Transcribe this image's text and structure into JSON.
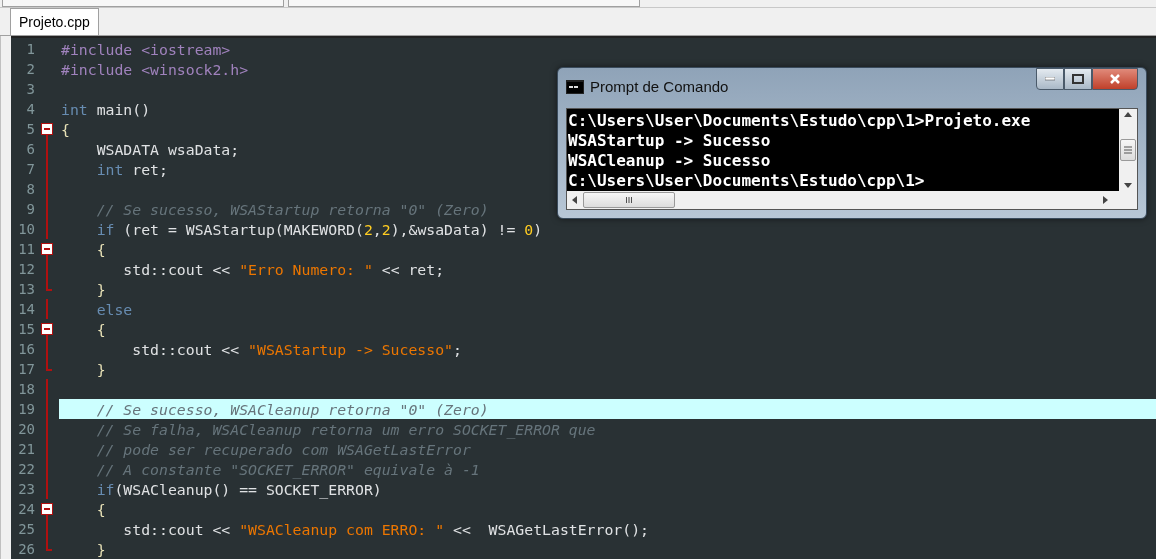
{
  "tabs": [
    {
      "label": "Projeto.cpp",
      "selected": true
    }
  ],
  "editor": {
    "lines": [
      {
        "number": "1",
        "kind": "plain",
        "highlighted": false,
        "tokens": [
          {
            "kind": "preproc",
            "text": "#include <iostream>"
          }
        ]
      },
      {
        "number": "2",
        "kind": "plain",
        "highlighted": false,
        "tokens": [
          {
            "kind": "preproc",
            "text": "#include <winsock2.h>"
          }
        ]
      },
      {
        "number": "3",
        "kind": "plain",
        "highlighted": false
      },
      {
        "number": "4",
        "kind": "plain",
        "highlighted": false,
        "tokens": [
          {
            "kind": "keyword",
            "text": "int"
          },
          {
            "kind": "plain",
            "text": " main()"
          }
        ]
      },
      {
        "number": "5",
        "kind": "opener",
        "highlighted": false,
        "tokens": [
          {
            "kind": "brace",
            "text": "{"
          }
        ]
      },
      {
        "number": "6",
        "kind": "inner",
        "highlighted": false,
        "tokens": [
          {
            "kind": "plain",
            "text": "    WSADATA wsaData;"
          }
        ]
      },
      {
        "number": "7",
        "kind": "inner",
        "highlighted": false,
        "tokens": [
          {
            "kind": "keyword",
            "text": "    int"
          },
          {
            "kind": "plain",
            "text": " ret;"
          }
        ]
      },
      {
        "number": "8",
        "kind": "inner",
        "highlighted": false
      },
      {
        "number": "9",
        "kind": "inner",
        "highlighted": false,
        "tokens": [
          {
            "kind": "comment",
            "text": "    // Se sucesso, WSAStartup retorna \"0\" (Zero)"
          }
        ]
      },
      {
        "number": "10",
        "kind": "inner",
        "highlighted": false,
        "tokens": [
          {
            "kind": "keyword",
            "text": "    if"
          },
          {
            "kind": "plain",
            "text": " (ret = WSAStartup(MAKEWORD("
          },
          {
            "kind": "number",
            "text": "2"
          },
          {
            "kind": "plain",
            "text": ","
          },
          {
            "kind": "number",
            "text": "2"
          },
          {
            "kind": "plain",
            "text": "),&wsaData) != "
          },
          {
            "kind": "number",
            "text": "0"
          },
          {
            "kind": "plain",
            "text": ")"
          }
        ]
      },
      {
        "number": "11",
        "kind": "opener",
        "highlighted": false,
        "tokens": [
          {
            "kind": "brace",
            "text": "    {"
          }
        ]
      },
      {
        "number": "12",
        "kind": "inner",
        "highlighted": false,
        "tokens": [
          {
            "kind": "plain",
            "text": "       std::cout << "
          },
          {
            "kind": "string",
            "text": "\"Erro Numero: \""
          },
          {
            "kind": "plain",
            "text": " << ret;"
          }
        ]
      },
      {
        "number": "13",
        "kind": "closer",
        "highlighted": false,
        "tokens": [
          {
            "kind": "brace",
            "text": "    }"
          }
        ]
      },
      {
        "number": "14",
        "kind": "inner",
        "highlighted": false,
        "tokens": [
          {
            "kind": "keyword",
            "text": "    else"
          }
        ]
      },
      {
        "number": "15",
        "kind": "opener",
        "highlighted": false,
        "tokens": [
          {
            "kind": "brace",
            "text": "    {"
          }
        ]
      },
      {
        "number": "16",
        "kind": "inner",
        "highlighted": false,
        "tokens": [
          {
            "kind": "plain",
            "text": "        std::cout << "
          },
          {
            "kind": "string",
            "text": "\"WSAStartup -> Sucesso\""
          },
          {
            "kind": "plain",
            "text": ";"
          }
        ]
      },
      {
        "number": "17",
        "kind": "closer",
        "highlighted": false,
        "tokens": [
          {
            "kind": "brace",
            "text": "    }"
          }
        ]
      },
      {
        "number": "18",
        "kind": "inner",
        "highlighted": false
      },
      {
        "number": "19",
        "kind": "inner",
        "highlighted": true,
        "tokens": [
          {
            "kind": "comment",
            "text": "    // Se sucesso, WSACleanup retorna \"0\" (Zero)"
          }
        ]
      },
      {
        "number": "20",
        "kind": "inner",
        "highlighted": false,
        "tokens": [
          {
            "kind": "comment",
            "text": "    // Se falha, WSACleanup retorna um erro SOCKET_ERROR que"
          }
        ]
      },
      {
        "number": "21",
        "kind": "inner",
        "highlighted": false,
        "tokens": [
          {
            "kind": "comment",
            "text": "    // pode ser recuperado com WSAGetLastError"
          }
        ]
      },
      {
        "number": "22",
        "kind": "inner",
        "highlighted": false,
        "tokens": [
          {
            "kind": "comment",
            "text": "    // A constante \"SOCKET_ERROR\" equivale à -1"
          }
        ]
      },
      {
        "number": "23",
        "kind": "inner",
        "highlighted": false,
        "tokens": [
          {
            "kind": "keyword",
            "text": "    if"
          },
          {
            "kind": "plain",
            "text": "(WSACleanup() == SOCKET_ERROR)"
          }
        ]
      },
      {
        "number": "24",
        "kind": "opener",
        "highlighted": false,
        "tokens": [
          {
            "kind": "brace",
            "text": "    {"
          }
        ]
      },
      {
        "number": "25",
        "kind": "inner",
        "highlighted": false,
        "tokens": [
          {
            "kind": "plain",
            "text": "       std::cout << "
          },
          {
            "kind": "string",
            "text": "\"WSACleanup com ERRO: \""
          },
          {
            "kind": "plain",
            "text": " <<  WSAGetLastError();"
          }
        ]
      },
      {
        "number": "26",
        "kind": "closer",
        "highlighted": false,
        "tokens": [
          {
            "kind": "brace",
            "text": "    }"
          }
        ]
      }
    ]
  },
  "console": {
    "title": "Prompt de Comando",
    "lines": [
      "C:\\Users\\User\\Documents\\Estudo\\cpp\\1>Projeto.exe",
      "WSAStartup -> Sucesso",
      "WSACleanup -> Sucesso",
      "C:\\Users\\User\\Documents\\Estudo\\cpp\\1>"
    ],
    "scroll_grip": "III"
  }
}
